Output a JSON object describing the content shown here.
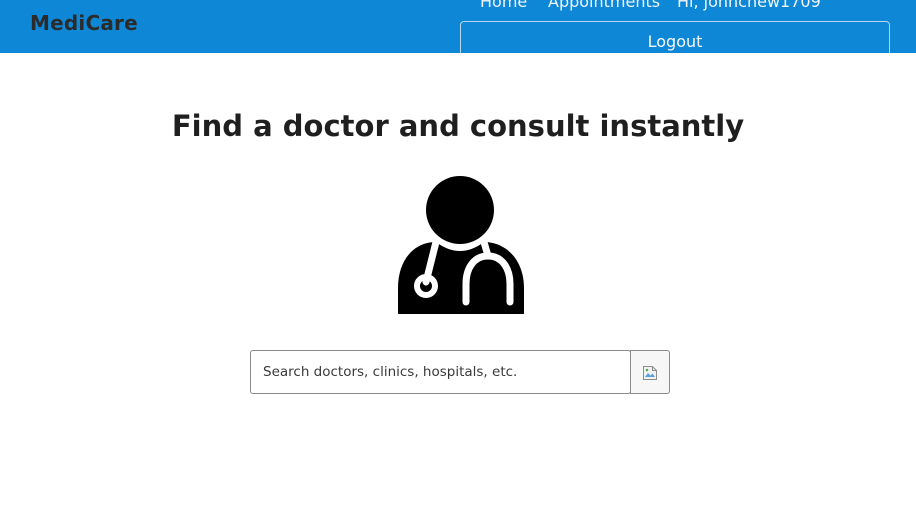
{
  "header": {
    "brand": "MediCare",
    "nav": {
      "home": "Home",
      "appointments": "Appointments",
      "greeting": "Hi, johnchew1709"
    },
    "logout": "Logout"
  },
  "main": {
    "title": "Find a doctor and consult instantly",
    "search": {
      "placeholder": "Search doctors, clinics, hospitals, etc.",
      "value": ""
    }
  },
  "icons": {
    "hero": "doctor-stethoscope-icon",
    "search_button": "broken-image-icon"
  },
  "colors": {
    "navbar": "#0d87d6",
    "brand_text": "#2b2b2b",
    "icon": "#000000"
  }
}
